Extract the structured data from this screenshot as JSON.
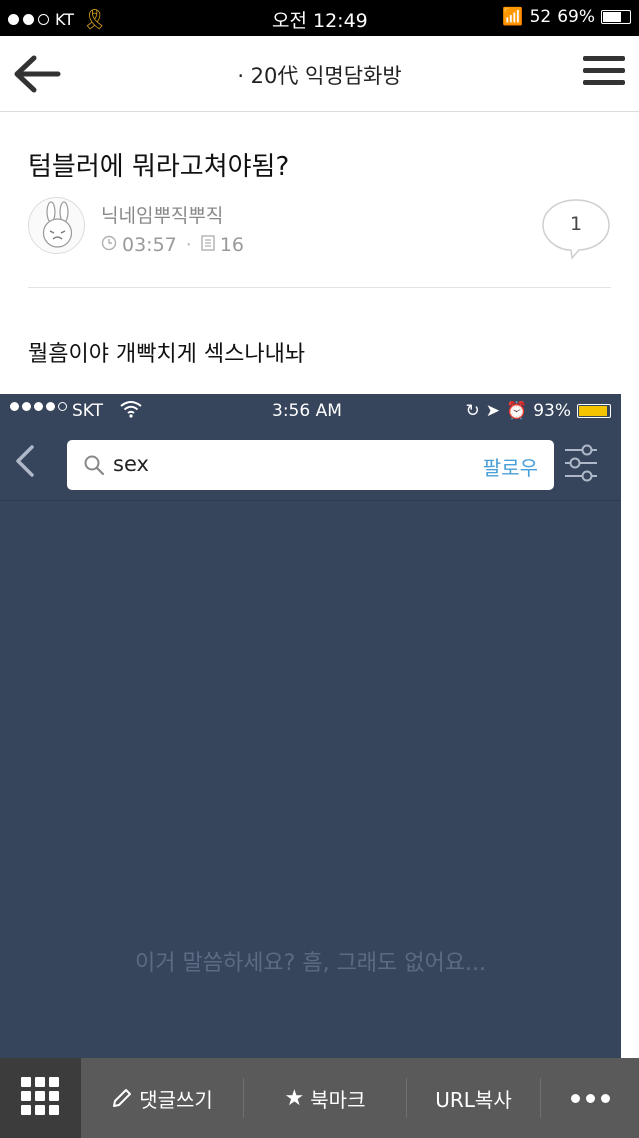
{
  "status_bar": {
    "carrier": "KT",
    "time": "오전 12:49",
    "network": "52",
    "battery_text": "69%",
    "battery_level": 0.69
  },
  "header": {
    "title": "· 20代 익명담화방"
  },
  "post": {
    "title": "텀블러에 뭐라고쳐야됨?",
    "author": "닉네임뿌직뿌직",
    "time": "03:57",
    "views": "16",
    "comment_count": "1",
    "body": "뭘흠이야 개빡치게 섹스나내놔"
  },
  "embedded": {
    "status": {
      "carrier": "SKT",
      "time": "3:56 AM",
      "battery_text": "93%",
      "battery_level": 0.93
    },
    "search": {
      "query": "sex",
      "follow_label": "팔로우"
    },
    "empty_message": "이거 말씀하세요? 흠, 그래도 없어요...",
    "colors": {
      "background": "#36445c",
      "follow": "#4aa0d8",
      "battery": "#f5c400"
    }
  },
  "toolbar": {
    "comment_label": "댓글쓰기",
    "bookmark_label": "북마크",
    "url_copy_label": "URL복사"
  },
  "icons": [
    "back-arrow-icon",
    "hamburger-menu-icon",
    "clock-icon",
    "document-icon",
    "speech-bubble-icon",
    "search-icon",
    "filter-sliders-icon",
    "grid-icon",
    "pencil-icon",
    "star-icon",
    "more-dots-icon"
  ]
}
